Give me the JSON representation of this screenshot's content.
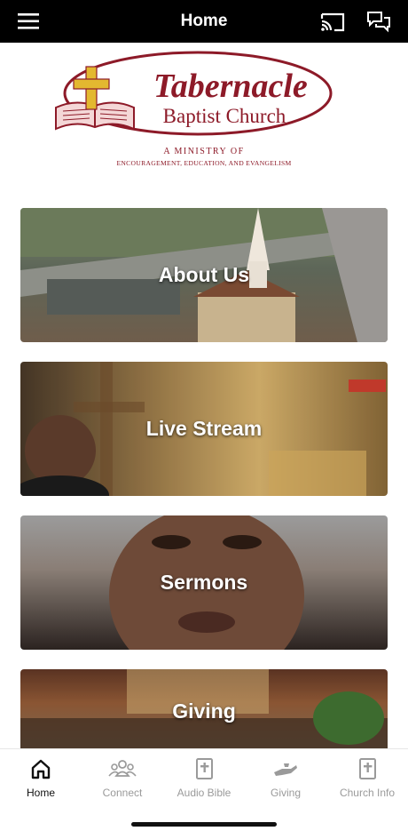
{
  "header": {
    "title": "Home",
    "menu_icon": "hamburger-menu-icon",
    "cast_icon": "cast-icon",
    "chat_icon": "chat-bubbles-icon"
  },
  "logo": {
    "title": "Tabernacle",
    "subtitle": "Baptist Church",
    "ministry_line": "A MINISTRY OF",
    "tagline": "ENCOURAGEMENT, EDUCATION, AND EVANGELISM",
    "brand_color": "#8d1a28",
    "accent_color": "#e3b830"
  },
  "cards": [
    {
      "label": "About Us"
    },
    {
      "label": "Live Stream"
    },
    {
      "label": "Sermons"
    },
    {
      "label": "Giving"
    }
  ],
  "nav": [
    {
      "label": "Home",
      "icon": "home-icon",
      "active": true
    },
    {
      "label": "Connect",
      "icon": "people-icon",
      "active": false
    },
    {
      "label": "Audio Bible",
      "icon": "bible-icon",
      "active": false
    },
    {
      "label": "Giving",
      "icon": "giving-hand-icon",
      "active": false
    },
    {
      "label": "Church Info",
      "icon": "church-info-icon",
      "active": false
    }
  ]
}
